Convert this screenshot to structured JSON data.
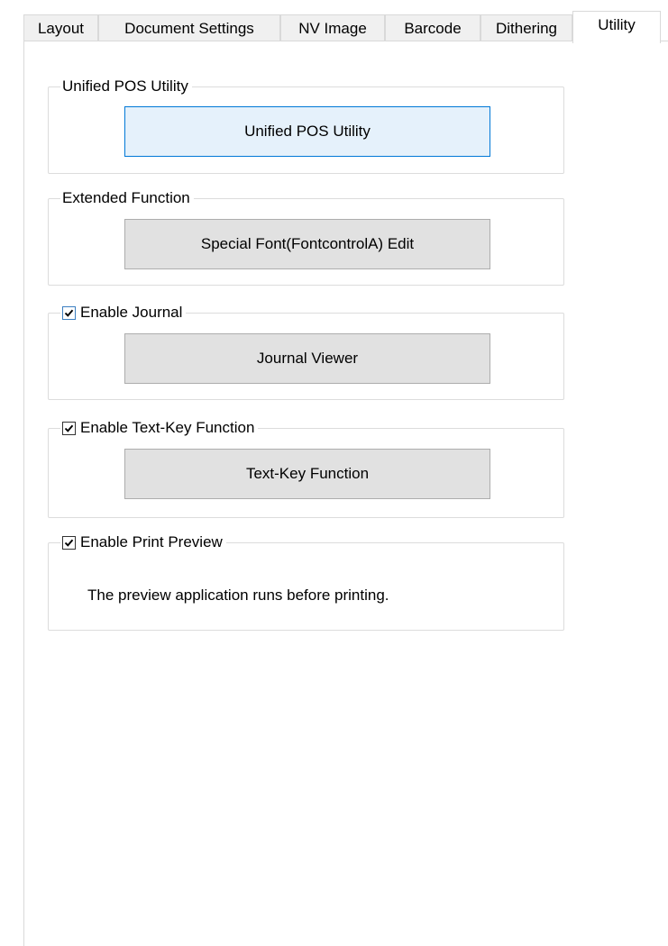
{
  "tabs": [
    {
      "label": "Layout",
      "active": false
    },
    {
      "label": "Document Settings",
      "active": false
    },
    {
      "label": "NV Image",
      "active": false
    },
    {
      "label": "Barcode",
      "active": false
    },
    {
      "label": "Dithering",
      "active": false
    },
    {
      "label": "Utility",
      "active": true
    }
  ],
  "groups": {
    "unified_pos": {
      "title": "Unified POS Utility",
      "button_label": "Unified POS Utility"
    },
    "extended": {
      "title": "Extended Function",
      "button_label": "Special Font(FontcontrolA) Edit"
    },
    "journal": {
      "title": "Enable Journal",
      "checked": true,
      "button_label": "Journal Viewer"
    },
    "text_key": {
      "title": "Enable Text-Key Function",
      "checked": true,
      "button_label": "Text-Key Function"
    },
    "print_preview": {
      "title": "Enable Print Preview",
      "checked": true,
      "description": "The preview application runs before printing."
    }
  },
  "colors": {
    "focus_accent": "#0078d7",
    "button_face": "#e1e1e1",
    "group_border": "#dcdcdc"
  }
}
